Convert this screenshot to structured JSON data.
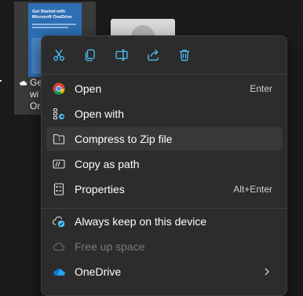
{
  "background": {
    "thumbnail_title": "Get Started with Microsoft OneDrive",
    "file_name_lines": [
      "Ge",
      "wi",
      "Or"
    ]
  },
  "toolbar": {
    "items": [
      {
        "name": "cut",
        "icon": "scissors-icon"
      },
      {
        "name": "copy",
        "icon": "copy-icon"
      },
      {
        "name": "rename",
        "icon": "rename-icon"
      },
      {
        "name": "share",
        "icon": "share-icon"
      },
      {
        "name": "delete",
        "icon": "trash-icon"
      }
    ]
  },
  "menu": {
    "items": [
      {
        "label": "Open",
        "shortcut": "Enter",
        "icon": "chrome-icon"
      },
      {
        "label": "Open with",
        "shortcut": "",
        "icon": "open-with-icon"
      },
      {
        "label": "Compress to Zip file",
        "shortcut": "",
        "icon": "zip-folder-icon"
      },
      {
        "label": "Copy as path",
        "shortcut": "",
        "icon": "copy-path-icon"
      },
      {
        "label": "Properties",
        "shortcut": "Alt+Enter",
        "icon": "properties-icon"
      },
      {
        "label": "Always keep on this device",
        "shortcut": "",
        "icon": "cloud-sync-icon"
      },
      {
        "label": "Free up space",
        "shortcut": "",
        "icon": "cloud-icon"
      },
      {
        "label": "OneDrive",
        "shortcut": "",
        "icon": "onedrive-icon"
      }
    ]
  },
  "colors": {
    "menu_bg": "#2c2c2c",
    "hover_bg": "#383838",
    "accent_blue": "#4cc2ff",
    "onedrive_blue": "#0f78d4"
  }
}
